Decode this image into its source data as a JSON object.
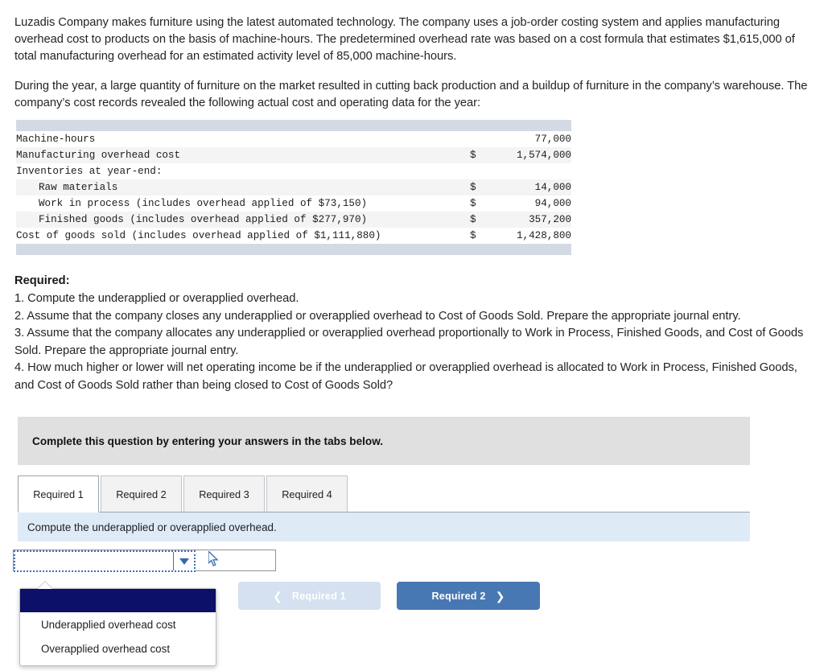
{
  "narrative": {
    "paragraph_1": "Luzadis Company makes furniture using the latest automated technology. The company uses a job-order costing system and applies manufacturing overhead cost to products on the basis of machine-hours. The predetermined overhead rate was based on a cost formula that estimates $1,615,000 of total manufacturing overhead for an estimated activity level of 85,000 machine-hours.",
    "paragraph_2": "During the year, a large quantity of furniture on the market resulted in cutting back production and a buildup of furniture in the company’s warehouse. The company’s cost records revealed the following actual cost and operating data for the year:"
  },
  "data_table": {
    "rows": [
      {
        "label": "Machine-hours",
        "indent": 0,
        "currency": "",
        "amount": "77,000",
        "stripe": false
      },
      {
        "label": "Manufacturing overhead cost",
        "indent": 0,
        "currency": "$",
        "amount": "1,574,000",
        "stripe": true
      },
      {
        "label": "Inventories at year-end:",
        "indent": 0,
        "currency": "",
        "amount": "",
        "stripe": false
      },
      {
        "label": "Raw materials",
        "indent": 1,
        "currency": "$",
        "amount": "14,000",
        "stripe": true
      },
      {
        "label": "Work in process (includes overhead applied of $73,150)",
        "indent": 1,
        "currency": "$",
        "amount": "94,000",
        "stripe": false
      },
      {
        "label": "Finished goods (includes overhead applied of $277,970)",
        "indent": 1,
        "currency": "$",
        "amount": "357,200",
        "stripe": true
      },
      {
        "label": "Cost of goods sold (includes overhead applied of $1,111,880)",
        "indent": 0,
        "currency": "$",
        "amount": "1,428,800",
        "stripe": false
      }
    ]
  },
  "required": {
    "heading": "Required:",
    "items": [
      "1. Compute the underapplied or overapplied overhead.",
      "2. Assume that the company closes any underapplied or overapplied overhead to Cost of Goods Sold. Prepare the appropriate journal entry.",
      "3. Assume that the company allocates any underapplied or overapplied overhead proportionally to Work in Process, Finished Goods, and Cost of Goods Sold. Prepare the appropriate journal entry.",
      "4. How much higher or lower will net operating income be if the underapplied or overapplied overhead is allocated to Work in Process, Finished Goods, and Cost of Goods Sold rather than being closed to Cost of Goods Sold?"
    ]
  },
  "answer_panel": {
    "complete_banner": "Complete this question by entering your answers in the tabs below.",
    "tabs": [
      {
        "label": "Required 1",
        "active": true
      },
      {
        "label": "Required 2",
        "active": false
      },
      {
        "label": "Required 3",
        "active": false
      },
      {
        "label": "Required 4",
        "active": false
      }
    ],
    "prompt": "Compute the underapplied or overapplied overhead.",
    "select": {
      "value": "",
      "options": [
        "",
        "Underapplied overhead cost",
        "Overapplied overhead cost"
      ],
      "selected_index": 0,
      "expanded": true
    },
    "amount_input": {
      "value": ""
    },
    "nav": {
      "prev_label": "Required 1",
      "prev_icon": "chevron-left-icon",
      "next_label": "Required 2",
      "next_icon": "chevron-right-icon"
    }
  },
  "colors": {
    "table_bar": "#d4dae4",
    "table_stripe": "#f4f4f4",
    "banner_gray": "#e0e0e0",
    "banner_blue": "#deebf7",
    "dropdown_highlight": "#0c1069",
    "btn_next": "#4878b4",
    "btn_prev": "#d5e1f0",
    "select_border": "#3f6fb5"
  }
}
